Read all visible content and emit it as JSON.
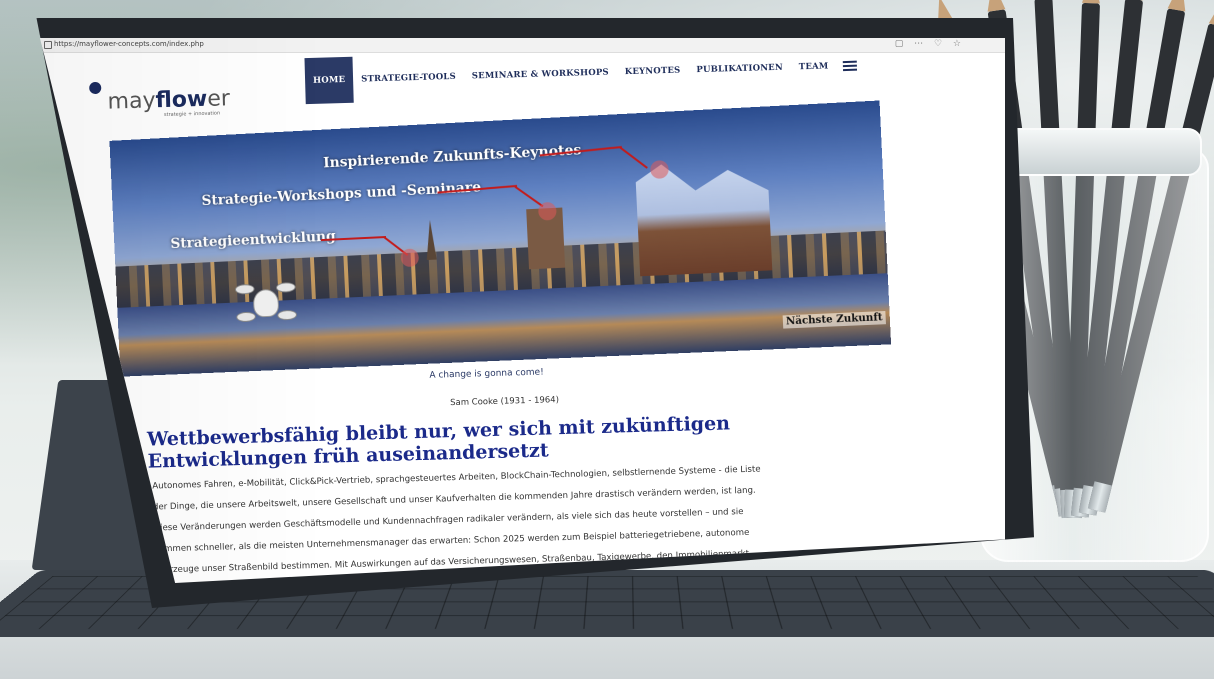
{
  "browser": {
    "url": "https://mayflower-concepts.com/index.php",
    "toolbar_icons": "▢ ⋯ ♡ ☆"
  },
  "site": {
    "logo_prefix": "may",
    "logo_bold": "flow",
    "logo_suffix": "er",
    "logo_sub": "strategie + innovation",
    "nav": [
      {
        "label": "HOME",
        "active": true
      },
      {
        "label": "STRATEGIE-TOOLS"
      },
      {
        "label": "SEMINARE & WORKSHOPS"
      },
      {
        "label": "KEYNOTES"
      },
      {
        "label": "PUBLIKATIONEN"
      },
      {
        "label": "TEAM"
      }
    ]
  },
  "hero": {
    "label_keynotes": "Inspirierende Zukunfts-Keynotes",
    "label_workshops": "Strategie-Workshops und -Seminare",
    "label_strategy": "Strategieentwicklung",
    "caption": "Nächste Zukunft"
  },
  "content": {
    "quote": "A change is gonna come!",
    "quote_author": "Sam Cooke (1931 - 1964)",
    "headline": "Wettbewerbsfähig bleibt nur, wer sich mit zukünftigen Entwicklungen früh auseinandersetzt",
    "body_lines": [
      "Autonomes Fahren, e-Mobilität, Click&Pick-Vertrieb, sprachgesteuertes Arbeiten, BlockChain-Technologien, selbstlernende Systeme - die Liste",
      "der Dinge, die unsere Arbeitswelt, unsere Gesellschaft und unser Kaufverhalten die kommenden Jahre drastisch verändern werden, ist lang.",
      "Diese Veränderungen werden Geschäftsmodelle und Kundennachfragen radikaler verändern, als viele sich das heute vorstellen – und sie",
      "kommen schneller, als die meisten Unternehmensmanager das erwarten: Schon 2025 werden zum Beispiel batteriegetriebene, autonome",
      "Fahrzeuge unser  Straßenbild bestimmen. Mit Auswirkungen auf das Versicherungswesen, Straßenbau, Taxigewerbe, den Immobilienmarkt,"
    ]
  },
  "colors": {
    "nav_active_bg": "#2b3a66",
    "headline": "#1b2a8a",
    "hero_line": "#c31b1b",
    "tablet_frame": "#23272c"
  }
}
